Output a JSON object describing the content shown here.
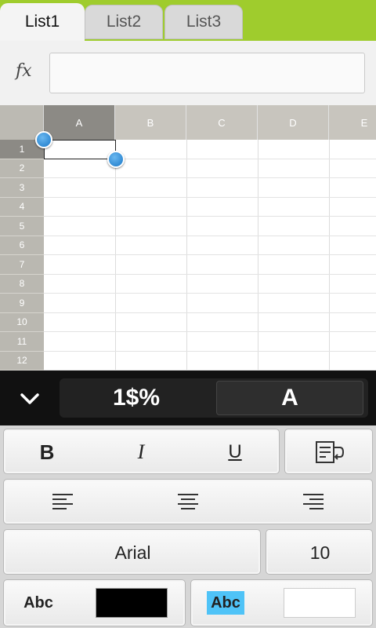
{
  "tabs": [
    {
      "label": "List1",
      "active": true
    },
    {
      "label": "List2",
      "active": false
    },
    {
      "label": "List3",
      "active": false
    }
  ],
  "formula_bar": {
    "label": "fx",
    "value": ""
  },
  "grid": {
    "columns": [
      "A",
      "B",
      "C",
      "D",
      "E"
    ],
    "rows": [
      "1",
      "2",
      "3",
      "4",
      "5",
      "6",
      "7",
      "8",
      "9",
      "10",
      "11",
      "12"
    ],
    "selected_cell": "A1"
  },
  "toolbar": {
    "collapse_icon": "chevron-down-icon",
    "number_format_label": "1$%",
    "text_format_label": "A"
  },
  "format_panel": {
    "bold_label": "B",
    "italic_label": "I",
    "underline_label": "U",
    "wrap_icon": "wrap-text-icon",
    "align_left_icon": "align-left-icon",
    "align_center_icon": "align-center-icon",
    "align_right_icon": "align-right-icon",
    "font_name": "Arial",
    "font_size": "10",
    "text_color_label": "Abc",
    "text_color": "#000000",
    "fill_color_label": "Abc",
    "fill_highlight": "#4fc3f7",
    "fill_color": "#ffffff"
  },
  "colors": {
    "tab_bar": "#9fcc2d",
    "selection_handle": "#1a78c8"
  }
}
